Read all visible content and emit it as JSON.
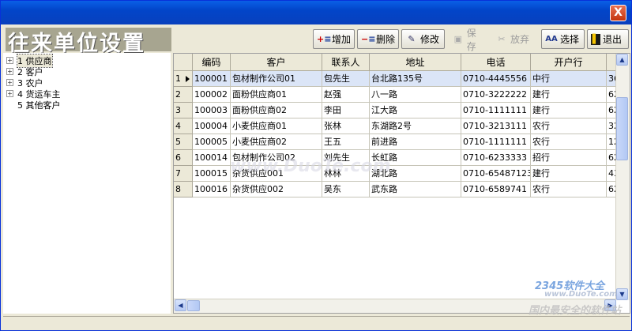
{
  "window": {
    "close_glyph": "X"
  },
  "brand": {
    "title": "往来单位设置"
  },
  "toolbar": {
    "add": "增加",
    "delete": "删除",
    "edit": "修改",
    "save": "保存",
    "discard": "放弃",
    "select": "选择",
    "exit": "退出"
  },
  "tree": [
    {
      "label": "1 供应商"
    },
    {
      "label": "2 客户"
    },
    {
      "label": "3 农户"
    },
    {
      "label": "4 货运车主"
    },
    {
      "label": "5 其他客户"
    }
  ],
  "grid": {
    "headers": [
      "编码",
      "客户",
      "联系人",
      "地址",
      "电话",
      "开户行"
    ],
    "rows": [
      {
        "n": "1",
        "cells": [
          "100001",
          "包材制作公司01",
          "包先生",
          "台北路135号",
          "0710-4445556",
          "中行",
          "36"
        ]
      },
      {
        "n": "2",
        "cells": [
          "100002",
          "面粉供应商01",
          "赵强",
          "八一路",
          "0710-3222222",
          "建行",
          "62"
        ]
      },
      {
        "n": "3",
        "cells": [
          "100003",
          "面粉供应商02",
          "李田",
          "江大路",
          "0710-1111111",
          "建行",
          "62"
        ]
      },
      {
        "n": "4",
        "cells": [
          "100004",
          "小麦供应商01",
          "张林",
          "东湖路2号",
          "0710-3213111",
          "农行",
          "32"
        ]
      },
      {
        "n": "5",
        "cells": [
          "100005",
          "小麦供应商02",
          "王五",
          "前进路",
          "0710-1111111",
          "农行",
          "12"
        ]
      },
      {
        "n": "6",
        "cells": [
          "100014",
          "包材制作公司02",
          "刘先生",
          "长虹路",
          "0710-6233333",
          "招行",
          "62"
        ]
      },
      {
        "n": "7",
        "cells": [
          "100015",
          "杂货供应001",
          "林林",
          "湖北路",
          "0710-65487123",
          "建行",
          "43"
        ]
      },
      {
        "n": "8",
        "cells": [
          "100016",
          "杂货供应002",
          "吴东",
          "武东路",
          "0710-6589741",
          "农行",
          "62"
        ]
      }
    ]
  },
  "watermarks": {
    "duote": "www.DuoTe.com",
    "brand": "2345软件大全",
    "brand_url": "www.DuoTe.com",
    "slogan": "国内最安全的软件站"
  },
  "colors": {
    "title_bar": "#0245c9",
    "selected_row": "#dbe5f7"
  }
}
